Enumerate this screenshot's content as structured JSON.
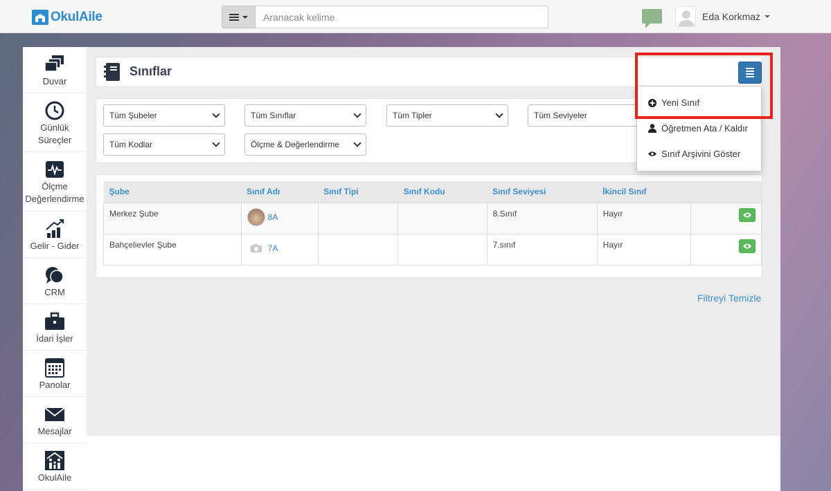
{
  "app": {
    "logo_text": "OkulAile"
  },
  "search": {
    "placeholder": "Aranacak kelime"
  },
  "user": {
    "name": "Eda Korkmaz"
  },
  "sidebar": {
    "items": [
      {
        "label": "Duvar",
        "icon": "wall-icon"
      },
      {
        "label": "Günlük Süreçler",
        "icon": "clock-icon"
      },
      {
        "label": "Ölçme Değerlendirme",
        "icon": "assessment-icon"
      },
      {
        "label": "Gelir - Gider",
        "icon": "growth-chart-icon"
      },
      {
        "label": "CRM",
        "icon": "chat-bubbles-icon"
      },
      {
        "label": "İdari İşler",
        "icon": "briefcase-icon"
      },
      {
        "label": "Panolar",
        "icon": "calendar-board-icon"
      },
      {
        "label": "Mesajlar",
        "icon": "envelope-icon"
      },
      {
        "label": "OkulAile",
        "icon": "family-icon"
      }
    ]
  },
  "page": {
    "title": "Sınıflar"
  },
  "filters": {
    "branch": "Tüm Şubeler",
    "classes": "Tüm Sınıflar",
    "types": "Tüm Tipler",
    "levels": "Tüm Seviyeler",
    "codes": "Tüm Kodlar",
    "assessment": "Ölçme & Değerlendirme"
  },
  "table": {
    "headers": [
      "Şube",
      "Sınıf Adı",
      "Sınıf Tipi",
      "Sınıf Kodu",
      "Sınıf Seviyesi",
      "İkincil Sınıf"
    ],
    "rows": [
      {
        "branch": "Merkez Şube",
        "class_name": "8A",
        "type": "",
        "code": "",
        "level": "8.Sınıf",
        "secondary": "Hayır"
      },
      {
        "branch": "Bahçelievler Şube",
        "class_name": "7A",
        "type": "",
        "code": "",
        "level": "7.sınıf",
        "secondary": "Hayır"
      }
    ]
  },
  "clear_filter": "Filtreyi Temizle",
  "dropdown": {
    "items": [
      {
        "label": "Yeni Sınıf",
        "icon": "plus-circle-icon"
      },
      {
        "label": "Öğretmen Ata / Kaldır",
        "icon": "user-icon"
      },
      {
        "label": "Sınıf Arşivini Göster",
        "icon": "eye-icon"
      }
    ]
  },
  "colors": {
    "accent": "#3276b1",
    "highlight": "#e8231e",
    "success": "#5cb85c",
    "link": "#3b8ed0"
  }
}
